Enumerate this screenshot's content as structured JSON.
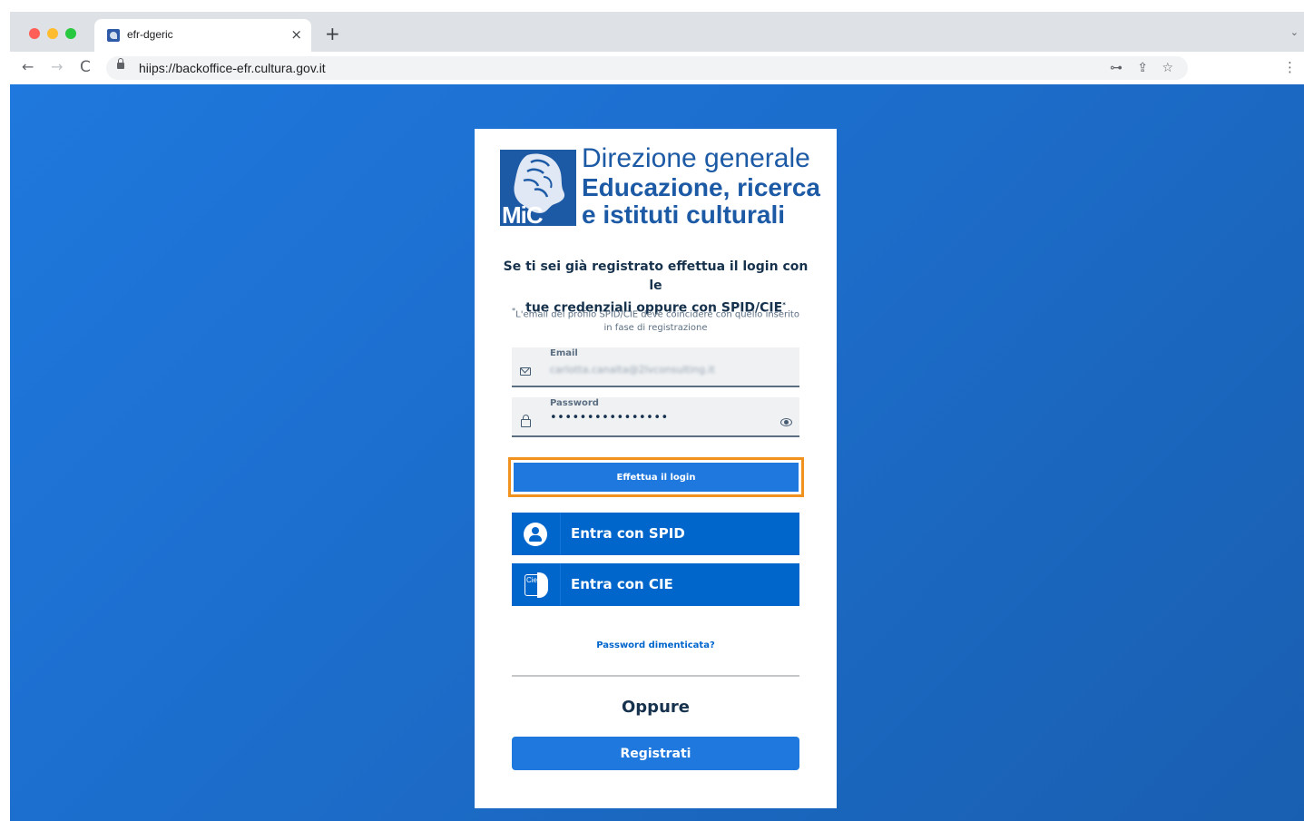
{
  "browser": {
    "tab_title": "efr-dgeric",
    "tab_close": "×",
    "new_tab": "+",
    "tab_menu": "⌄",
    "url": "hiips://backoffice-efr.cultura.gov.it",
    "nav_back": "←",
    "nav_forward": "→",
    "nav_reload": "C",
    "key_icon": "⊶",
    "share_icon": "⇪",
    "star_icon": "☆",
    "menu_icon": "⋮"
  },
  "logo": {
    "mark_text": "MiC",
    "line1": "Direzione generale",
    "line2": "Educazione, ricerca",
    "line3": "e istituti culturali",
    "color": "#1d5aa6"
  },
  "login": {
    "heading_line1": "Se ti sei già registrato effettua il login con le",
    "heading_line2": "tue credenziali oppure con SPID/CIE",
    "heading_mark": "*",
    "note_mark": "*",
    "note_line1": "L'email del profilo SPID/CIE deve coincidere con quello inserito",
    "note_line2": "in fase di registrazione",
    "email": {
      "label": "Email",
      "value": "carlotta.canalta@2lvconsulting.it",
      "icon": "mail-icon"
    },
    "password": {
      "label": "Password",
      "value": "••••••••••••••••",
      "icon": "lock-icon"
    },
    "login_button": "Effettua il login",
    "spid_button": "Entra con SPID",
    "cie_button": "Entra con CIE",
    "cie_icon_text": "Cie ID",
    "forgot_link": "Password dimenticata?",
    "or_label": "Oppure",
    "register_button": "Registrati"
  },
  "colors": {
    "accent": "#1f78dd",
    "id_button": "#0066cc",
    "highlight": "#f0921d",
    "text_dark": "#17324d"
  }
}
